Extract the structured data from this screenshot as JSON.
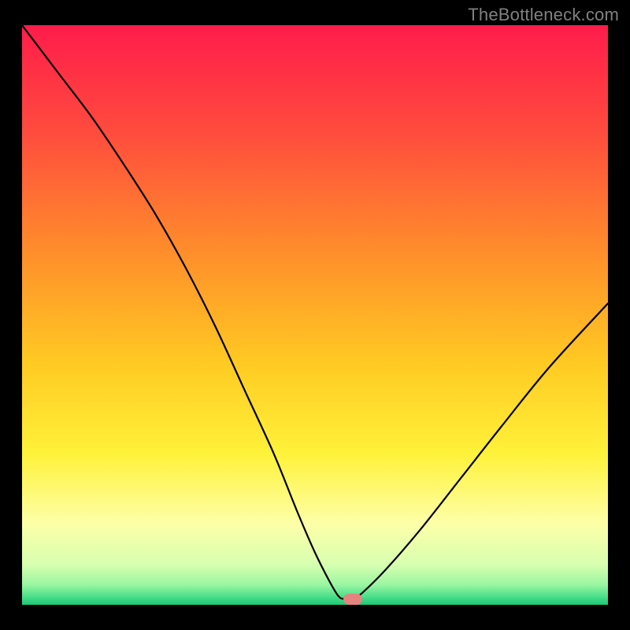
{
  "source_watermark": "TheBottleneck.com",
  "chart_data": {
    "type": "line",
    "title": "",
    "xlabel": "",
    "ylabel": "",
    "xlim": [
      0,
      100
    ],
    "ylim": [
      0,
      100
    ],
    "grid": false,
    "legend": false,
    "background": {
      "type": "vertical-gradient",
      "stops": [
        {
          "pos": 0.0,
          "color": "#ff1c4b"
        },
        {
          "pos": 0.18,
          "color": "#ff4a3e"
        },
        {
          "pos": 0.38,
          "color": "#ff8a2c"
        },
        {
          "pos": 0.58,
          "color": "#ffc922"
        },
        {
          "pos": 0.74,
          "color": "#fff23a"
        },
        {
          "pos": 0.86,
          "color": "#fdffa8"
        },
        {
          "pos": 0.93,
          "color": "#d8ffb0"
        },
        {
          "pos": 0.965,
          "color": "#9bf6a2"
        },
        {
          "pos": 0.985,
          "color": "#4fe08b"
        },
        {
          "pos": 1.0,
          "color": "#1cc877"
        }
      ]
    },
    "series": [
      {
        "name": "bottleneck-curve",
        "color": "#000000",
        "width": 2.2,
        "x": [
          0,
          6,
          12,
          18,
          23,
          28,
          33,
          38,
          43,
          47,
          50,
          52.5,
          54,
          55,
          56.5,
          58,
          62,
          68,
          75,
          82,
          90,
          100
        ],
        "y": [
          100,
          92,
          84,
          75,
          67,
          58,
          48,
          37,
          26,
          16,
          9,
          4,
          1.5,
          1,
          1,
          2,
          6,
          13,
          22,
          31,
          41,
          52
        ]
      }
    ],
    "marker": {
      "x": 56.5,
      "y": 1,
      "color": "#e4847f",
      "shape": "pill"
    }
  }
}
